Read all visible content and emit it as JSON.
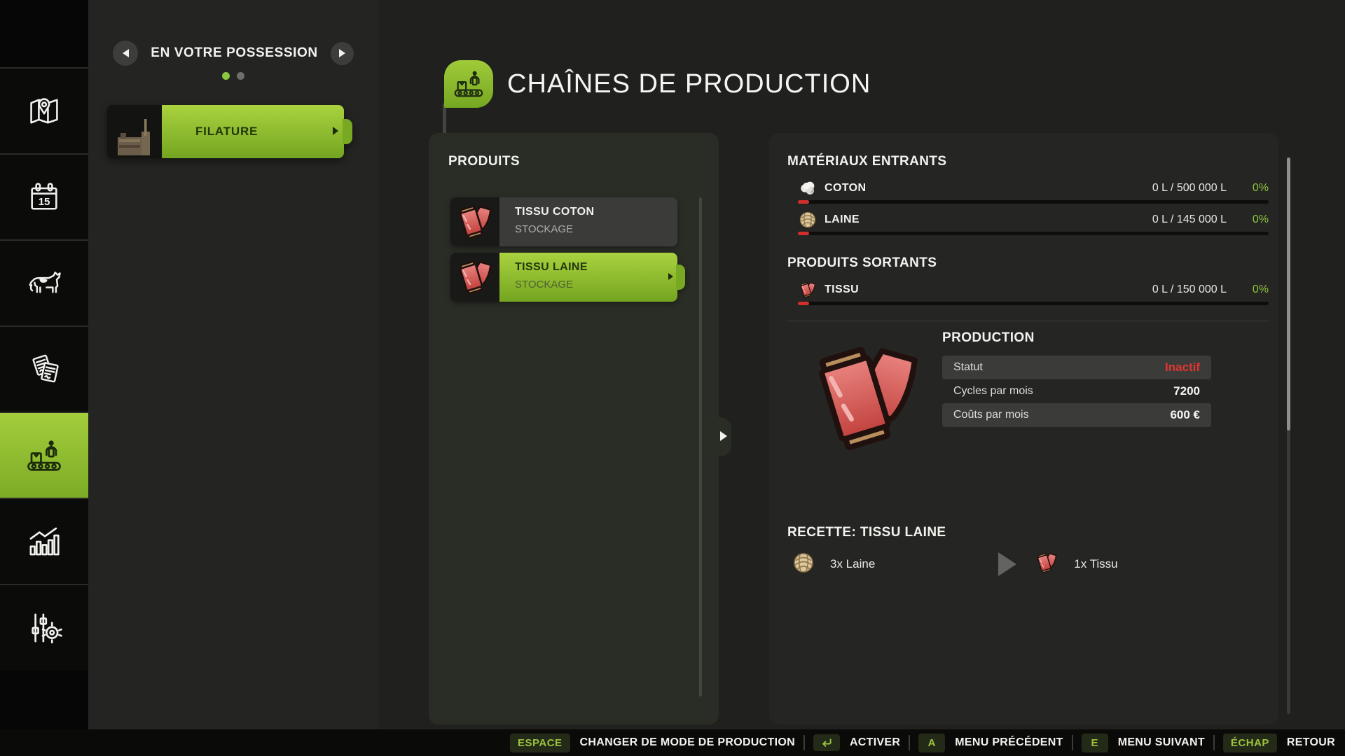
{
  "sidebar": {
    "calendar_day": "15"
  },
  "possession": {
    "title": "EN VOTRE POSSESSION",
    "items": [
      {
        "title": "FILATURE"
      }
    ]
  },
  "header": {
    "title": "CHAÎNES DE PRODUCTION"
  },
  "products": {
    "title": "PRODUITS",
    "items": [
      {
        "name": "TISSU COTON",
        "status": "STOCKAGE"
      },
      {
        "name": "TISSU LAINE",
        "status": "STOCKAGE"
      }
    ]
  },
  "materials_in": {
    "title": "MATÉRIAUX ENTRANTS",
    "rows": [
      {
        "label": "COTON",
        "value": "0 L / 500 000 L",
        "percent": "0%"
      },
      {
        "label": "LAINE",
        "value": "0 L / 145 000 L",
        "percent": "0%"
      }
    ]
  },
  "products_out": {
    "title": "PRODUITS SORTANTS",
    "rows": [
      {
        "label": "TISSU",
        "value": "0 L / 150 000 L",
        "percent": "0%"
      }
    ]
  },
  "production": {
    "title": "PRODUCTION",
    "rows": [
      {
        "label": "Statut",
        "value": "Inactif"
      },
      {
        "label": "Cycles par mois",
        "value": "7200"
      },
      {
        "label": "Coûts par mois",
        "value": "600 €"
      }
    ]
  },
  "recipe": {
    "title": "RECETTE: TISSU LAINE",
    "input": "3x Laine",
    "output": "1x Tissu"
  },
  "hotkeys": [
    {
      "key": "ESPACE",
      "label": "CHANGER DE MODE DE PRODUCTION"
    },
    {
      "key": "↵",
      "label": "ACTIVER"
    },
    {
      "key": "A",
      "label": "MENU PRÉCÉDENT"
    },
    {
      "key": "E",
      "label": "MENU SUIVANT"
    },
    {
      "key": "ÉCHAP",
      "label": "RETOUR"
    }
  ],
  "colors": {
    "accent": "#8dc63f",
    "inactive": "#e23531"
  }
}
